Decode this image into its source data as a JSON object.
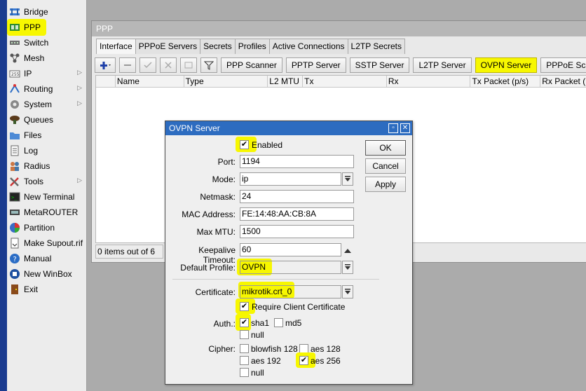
{
  "sidebar": {
    "items": [
      {
        "label": "Bridge",
        "icon": "bridge-icon",
        "arrow": false
      },
      {
        "label": "PPP",
        "icon": "ppp-icon",
        "arrow": false
      },
      {
        "label": "Switch",
        "icon": "switch-icon",
        "arrow": false
      },
      {
        "label": "Mesh",
        "icon": "mesh-icon",
        "arrow": false
      },
      {
        "label": "IP",
        "icon": "ip-icon",
        "arrow": true
      },
      {
        "label": "Routing",
        "icon": "routing-icon",
        "arrow": true
      },
      {
        "label": "System",
        "icon": "system-icon",
        "arrow": true
      },
      {
        "label": "Queues",
        "icon": "queues-icon",
        "arrow": false
      },
      {
        "label": "Files",
        "icon": "files-icon",
        "arrow": false
      },
      {
        "label": "Log",
        "icon": "log-icon",
        "arrow": false
      },
      {
        "label": "Radius",
        "icon": "radius-icon",
        "arrow": false
      },
      {
        "label": "Tools",
        "icon": "tools-icon",
        "arrow": true
      },
      {
        "label": "New Terminal",
        "icon": "terminal-icon",
        "arrow": false
      },
      {
        "label": "MetaROUTER",
        "icon": "metarouter-icon",
        "arrow": false
      },
      {
        "label": "Partition",
        "icon": "partition-icon",
        "arrow": false
      },
      {
        "label": "Make Supout.rif",
        "icon": "supout-icon",
        "arrow": false
      },
      {
        "label": "Manual",
        "icon": "manual-icon",
        "arrow": false
      },
      {
        "label": "New WinBox",
        "icon": "winbox-icon",
        "arrow": false
      },
      {
        "label": "Exit",
        "icon": "exit-icon",
        "arrow": false
      }
    ]
  },
  "ppp_window": {
    "title": "PPP",
    "tabs": [
      "Interface",
      "PPPoE Servers",
      "Secrets",
      "Profiles",
      "Active Connections",
      "L2TP Secrets"
    ],
    "active_tab": "Interface",
    "toolbar_buttons": [
      "PPP Scanner",
      "PPTP Server",
      "SSTP Server",
      "L2TP Server",
      "OVPN Server",
      "PPPoE Scan"
    ],
    "columns": [
      "",
      "Name",
      "Type",
      "L2 MTU",
      "Tx",
      "Rx",
      "Tx Packet (p/s)",
      "Rx Packet (p/s)"
    ],
    "status": "0 items out of 6"
  },
  "dialog": {
    "title": "OVPN Server",
    "enabled_label": "Enabled",
    "enabled": true,
    "port_label": "Port:",
    "port": "1194",
    "mode_label": "Mode:",
    "mode": "ip",
    "netmask_label": "Netmask:",
    "netmask": "24",
    "mac_label": "MAC Address:",
    "mac": "FE:14:48:AA:CB:8A",
    "maxmtu_label": "Max MTU:",
    "maxmtu": "1500",
    "keepalive_label": "Keepalive Timeout:",
    "keepalive": "60",
    "profile_label": "Default Profile:",
    "profile": "OVPN",
    "cert_label": "Certificate:",
    "cert": "mikrotik.crt_0",
    "require_cert_label": "Require Client Certificate",
    "require_cert": true,
    "auth_label": "Auth.:",
    "auth": {
      "sha1": true,
      "md5": false,
      "null": false
    },
    "cipher_label": "Cipher:",
    "cipher": {
      "blowfish128": false,
      "aes128": false,
      "aes192": false,
      "aes256": true,
      "null": false
    },
    "labels": {
      "sha1": "sha1",
      "md5": "md5",
      "null": "null",
      "blowfish128": "blowfish 128",
      "aes128": "aes 128",
      "aes192": "aes 192",
      "aes256": "aes 256"
    },
    "buttons": {
      "ok": "OK",
      "cancel": "Cancel",
      "apply": "Apply"
    }
  },
  "colors": {
    "highlight": "#f7f700",
    "titlebar": "#2d6cc0",
    "accent_blue": "#1a3b8f"
  }
}
